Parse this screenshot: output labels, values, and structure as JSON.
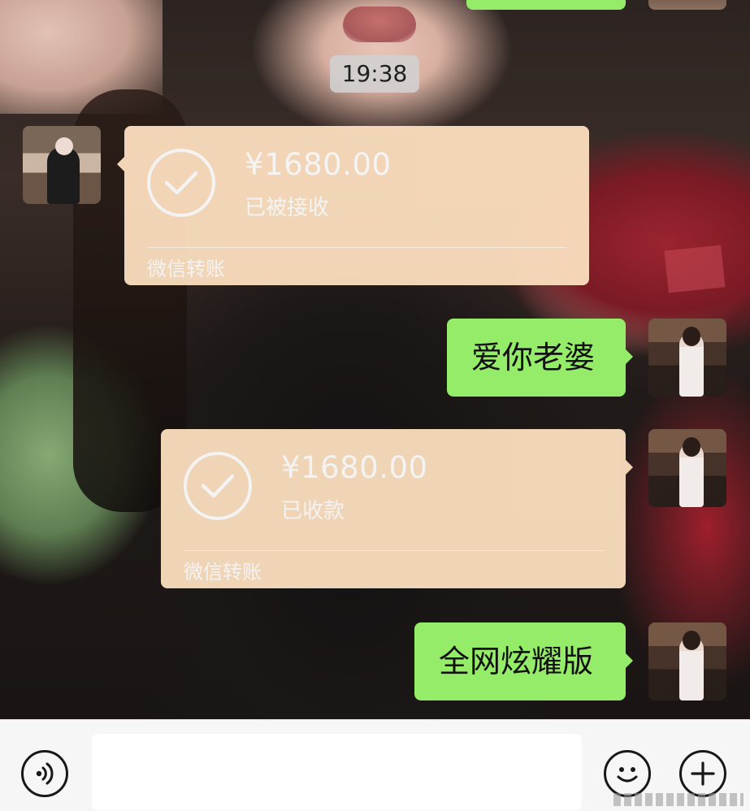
{
  "chat": {
    "time_divider": "19:38",
    "messages": [
      {
        "type": "transfer",
        "side": "left",
        "amount": "¥1680.00",
        "status": "已被接收",
        "label": "微信转账"
      },
      {
        "type": "text",
        "side": "right",
        "text": "爱你老婆"
      },
      {
        "type": "transfer",
        "side": "right",
        "amount": "¥1680.00",
        "status": "已收款",
        "label": "微信转账"
      },
      {
        "type": "text",
        "side": "right",
        "text": "全网炫耀版"
      }
    ]
  },
  "input_bar": {
    "voice_icon": "voice-icon",
    "text_value": "",
    "emoji_icon": "emoji-icon",
    "plus_icon": "plus-icon"
  },
  "colors": {
    "bubble_green": "#95ec69",
    "transfer_orange": "#fcdfbf",
    "input_bar_bg": "#f6f6f6"
  }
}
